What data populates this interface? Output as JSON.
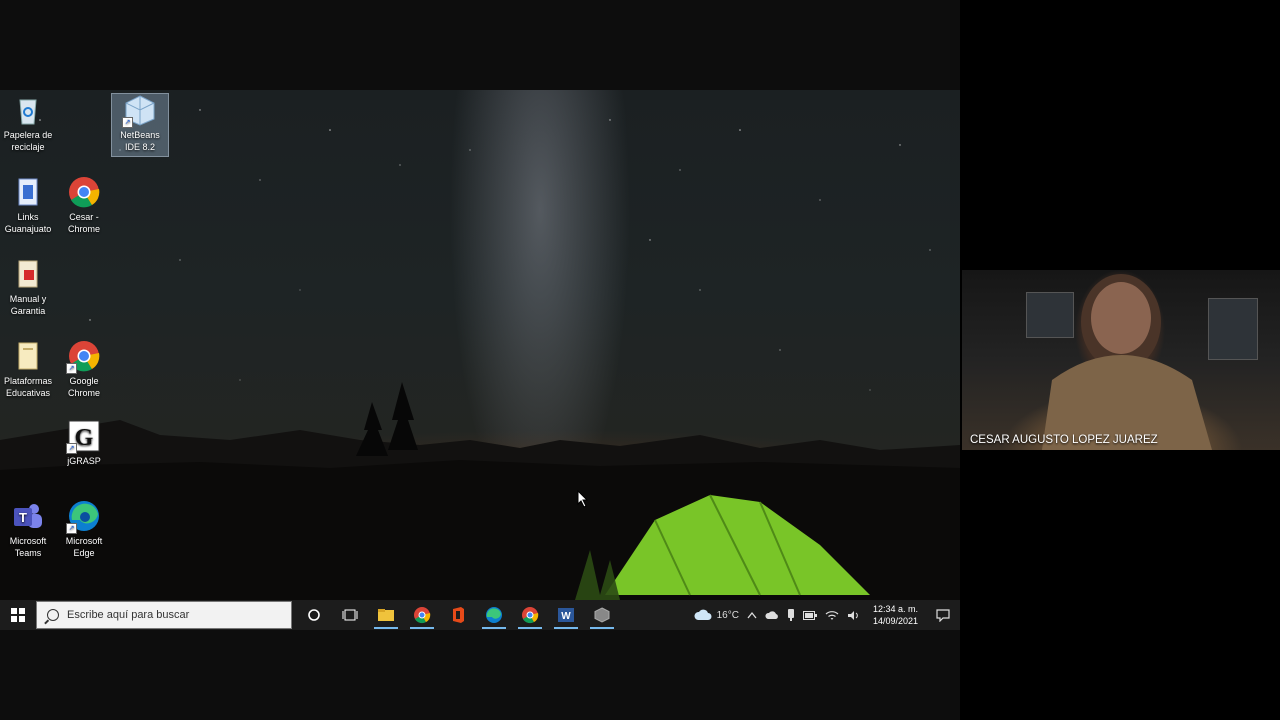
{
  "desktop_icons": [
    {
      "id": "recycle",
      "label": "Papelera de reciclaje",
      "icon": "recycle-bin-icon"
    },
    {
      "id": "netbeans",
      "label": "NetBeans IDE 8.2",
      "icon": "netbeans-icon"
    },
    {
      "id": "links",
      "label": "Links Guanajuato",
      "icon": "document-icon"
    },
    {
      "id": "cesar-chrome",
      "label": "Cesar - Chrome",
      "icon": "chrome-icon"
    },
    {
      "id": "manual",
      "label": "Manual y Garantia",
      "icon": "pdf-icon"
    },
    {
      "id": "plataformas",
      "label": "Plataformas Educativas",
      "icon": "folder-icon"
    },
    {
      "id": "google-chrome",
      "label": "Google Chrome",
      "icon": "chrome-icon"
    },
    {
      "id": "jgrasp",
      "label": "jGRASP",
      "icon": "jgrasp-icon"
    },
    {
      "id": "teams",
      "label": "Microsoft Teams",
      "icon": "teams-icon"
    },
    {
      "id": "edge",
      "label": "Microsoft Edge",
      "icon": "edge-icon"
    }
  ],
  "taskbar": {
    "search_placeholder": "Escribe aquí para buscar",
    "pinned": [
      "file-explorer-icon",
      "chrome-icon",
      "office-icon",
      "edge-icon",
      "chrome-profile-icon",
      "word-icon",
      "netbeans-icon"
    ],
    "weather": "16°C",
    "time": "12:34 a. m.",
    "date": "14/09/2021"
  },
  "participant": {
    "name": "CESAR AUGUSTO LOPEZ JUAREZ"
  },
  "colors": {
    "taskbar": "#1c1c1c",
    "active_indicator": "#76b9ed",
    "tent_green": "#7fd02a"
  }
}
